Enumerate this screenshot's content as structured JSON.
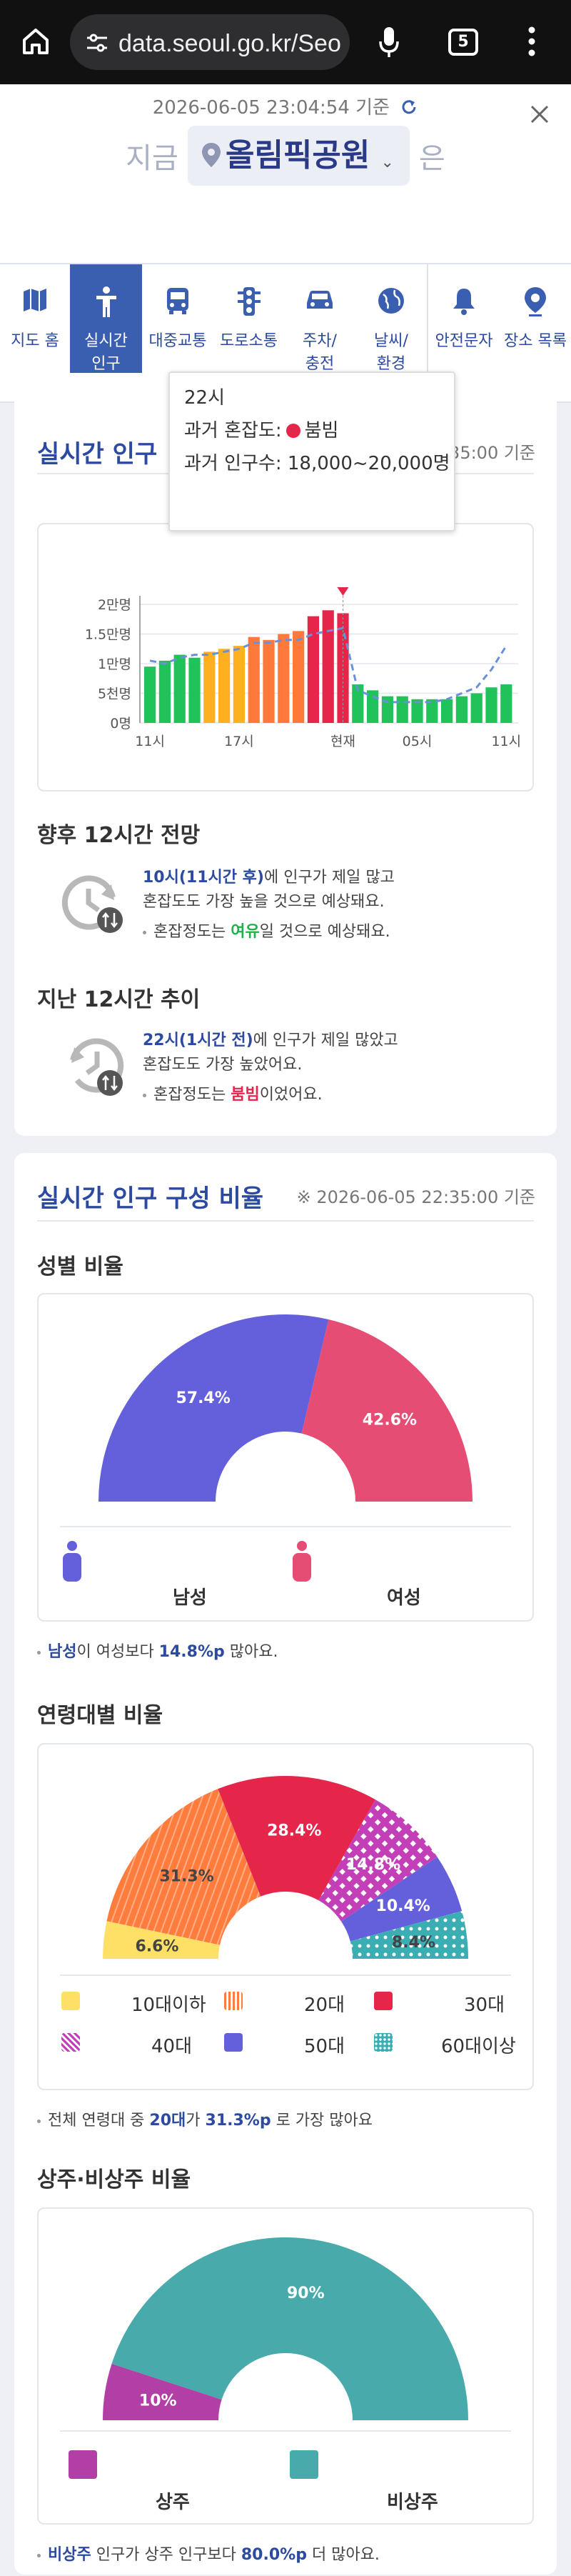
{
  "browser": {
    "url": "data.seoul.go.kr/Seo",
    "tab_count": "5"
  },
  "header": {
    "timestamp": "2026-06-05 23:04:54 기준",
    "prefix": "지금",
    "place": "올림픽공원",
    "suffix": "은"
  },
  "nav": {
    "items": [
      {
        "label": "지도 홈",
        "icon": "map-icon"
      },
      {
        "label": "실시간\n인구",
        "icon": "person-icon",
        "active": true
      },
      {
        "label": "대중교통",
        "icon": "bus-icon"
      },
      {
        "label": "도로소통",
        "icon": "traffic-light-icon"
      },
      {
        "label": "주차/\n충전",
        "icon": "car-icon"
      },
      {
        "label": "날씨/\n환경",
        "icon": "globe-icon"
      },
      {
        "label": "안전문자",
        "icon": "bell-icon"
      },
      {
        "label": "장소 목록",
        "icon": "location-pin-icon"
      }
    ]
  },
  "population": {
    "title": "실시간 인구",
    "timestamp": "35:00 기준",
    "tooltip": {
      "time": "22시",
      "congestion_label": "과거 혼잡도:",
      "congestion_value": "붐빔",
      "count_label": "과거 인구수:",
      "count_value": "18,000~20,000명"
    },
    "forecast_title": "향후 12시간 전망",
    "forecast_hl": "10시(11시간 후)",
    "forecast_line1_rest": "에 인구가 제일 많고",
    "forecast_line2": "혼잡도도 가장 높을 것으로 예상돼요.",
    "forecast_cong_pre": "혼잡정도는 ",
    "forecast_cong_val": "여유",
    "forecast_cong_post": "일 것으로 예상돼요.",
    "past_title": "지난 12시간 추이",
    "past_hl": "22시(1시간 전)",
    "past_line1_rest": "에 인구가 제일 많았고",
    "past_line2": "혼잡도도 가장 높았어요.",
    "past_cong_pre": "혼잡정도는 ",
    "past_cong_val": "붐빔",
    "past_cong_post": "이었어요."
  },
  "composition": {
    "title": "실시간 인구 구성 비율",
    "timestamp": "※ 2026-06-05 22:35:00 기준",
    "gender_title": "성별 비율",
    "male_label": "남성",
    "female_label": "여성",
    "gender_note_pre": "이 여성보다 ",
    "gender_note_subject": "남성",
    "gender_note_val": "14.8%p",
    "gender_note_post": " 많아요.",
    "age_title": "연령대별 비율",
    "age_note_pre": "전체 연령대 중 ",
    "age_note_subject": "20대",
    "age_note_mid": "가 ",
    "age_note_val": "31.3%p",
    "age_note_post": " 로 가장 많아요",
    "resident_title": "상주·비상주 비율",
    "resident_label": "상주",
    "nonresident_label": "비상주",
    "res_note_subject": "비상주",
    "res_note_mid": " 인구가 상주 인구보다 ",
    "res_note_val": "80.0%p",
    "res_note_post": " 더 많아요."
  },
  "chart_data": [
    {
      "type": "bar",
      "title": "",
      "x_ticks": [
        "11시",
        "17시",
        "현재",
        "05시",
        "11시"
      ],
      "y_ticks": [
        "0명",
        "5천명",
        "1만명",
        "1.5만명",
        "2만명"
      ],
      "ylim": [
        0,
        22000
      ],
      "values": [
        9500,
        10500,
        11500,
        11000,
        12000,
        12500,
        13000,
        14500,
        14000,
        15000,
        15500,
        18000,
        19000,
        18500,
        6500,
        5500,
        4500,
        4500,
        4000,
        4000,
        4000,
        4500,
        5000,
        6000,
        6500
      ],
      "bar_colors": [
        "#1fc35a",
        "#1fc35a",
        "#1fc35a",
        "#1fc35a",
        "#ffb020",
        "#ffb020",
        "#ffb020",
        "#ff7a3a",
        "#ff7a3a",
        "#ff7a3a",
        "#ff7a3a",
        "#e5264a",
        "#e5264a",
        "#e5264a",
        "#1fc35a",
        "#1fc35a",
        "#1fc35a",
        "#1fc35a",
        "#1fc35a",
        "#1fc35a",
        "#1fc35a",
        "#1fc35a",
        "#1fc35a",
        "#1fc35a",
        "#1fc35a"
      ],
      "trend_line": [
        10500,
        10000,
        11000,
        11500,
        11500,
        12000,
        12500,
        13500,
        13500,
        14000,
        14000,
        15000,
        15500,
        16000,
        5500,
        4500,
        3500,
        3500,
        3500,
        3500,
        4000,
        5000,
        6000,
        9000,
        13000
      ],
      "current_index": 13
    },
    {
      "type": "pie",
      "title": "성별 비율",
      "categories": [
        "남성",
        "여성"
      ],
      "values": [
        57.4,
        42.6
      ],
      "colors": [
        "#6460dc",
        "#e54d74"
      ]
    },
    {
      "type": "pie",
      "title": "연령대별 비율",
      "categories": [
        "10대이하",
        "20대",
        "30대",
        "40대",
        "50대",
        "60대이상"
      ],
      "values": [
        6.6,
        31.3,
        28.4,
        14.8,
        10.4,
        8.4
      ],
      "colors": [
        "#ffe066",
        "#ff7c3c",
        "#e5264a",
        "#c23fb8",
        "#6460dc",
        "#3aaeb3"
      ]
    },
    {
      "type": "pie",
      "title": "상주·비상주 비율",
      "categories": [
        "상주",
        "비상주"
      ],
      "values": [
        10,
        90
      ],
      "colors": [
        "#b13fa6",
        "#48aaaa"
      ]
    }
  ]
}
